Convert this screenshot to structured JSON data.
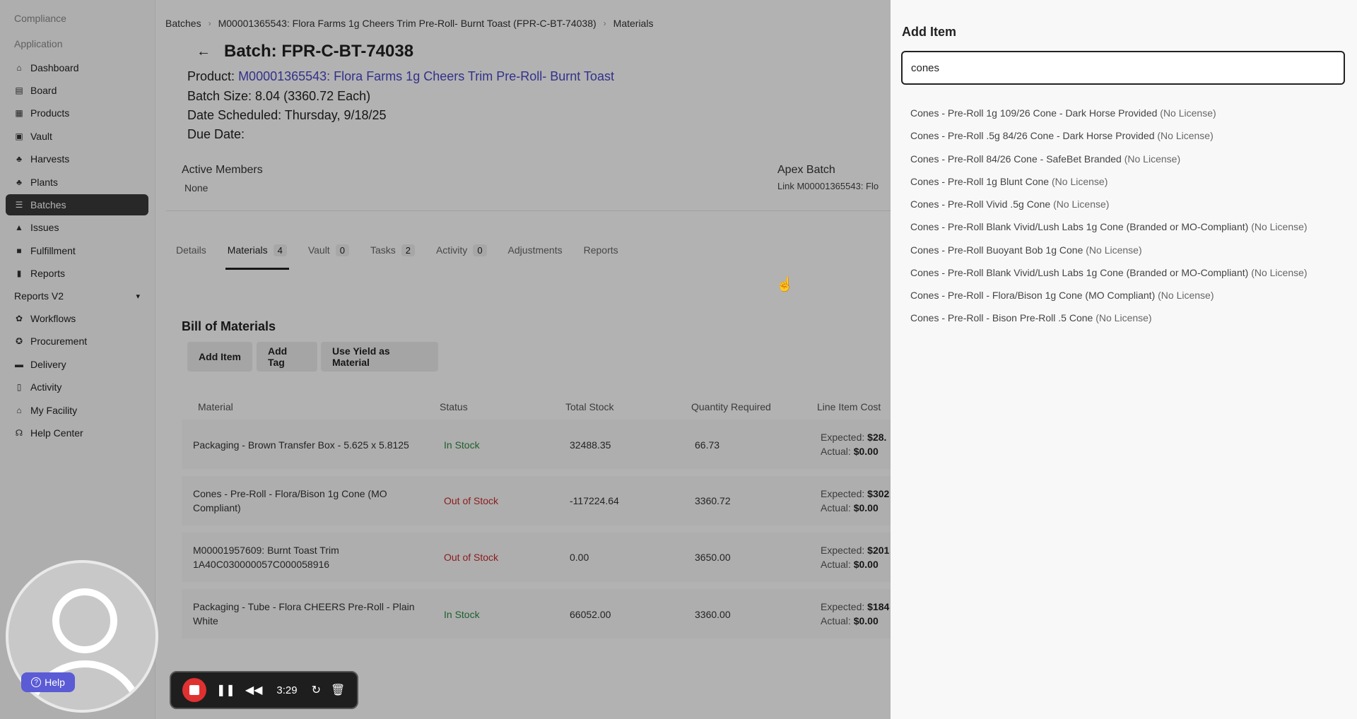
{
  "sidebar": {
    "sections": [
      "Compliance",
      "Application"
    ],
    "items": [
      {
        "label": "Dashboard",
        "icon": "home-icon"
      },
      {
        "label": "Board",
        "icon": "board-icon"
      },
      {
        "label": "Products",
        "icon": "products-icon"
      },
      {
        "label": "Vault",
        "icon": "vault-icon"
      },
      {
        "label": "Harvests",
        "icon": "harvest-icon"
      },
      {
        "label": "Plants",
        "icon": "plant-icon"
      },
      {
        "label": "Batches",
        "icon": "batches-icon",
        "active": true
      },
      {
        "label": "Issues",
        "icon": "warning-icon"
      },
      {
        "label": "Fulfillment",
        "icon": "fulfillment-icon"
      },
      {
        "label": "Reports",
        "icon": "chart-icon"
      },
      {
        "label": "Reports V2",
        "icon": "chevron-down-icon"
      },
      {
        "label": "Workflows",
        "icon": "workflow-icon"
      },
      {
        "label": "Procurement",
        "icon": "procurement-icon"
      },
      {
        "label": "Delivery",
        "icon": "truck-icon"
      },
      {
        "label": "Activity",
        "icon": "activity-icon"
      },
      {
        "label": "My Facility",
        "icon": "facility-icon"
      },
      {
        "label": "Help Center",
        "icon": "headset-icon"
      }
    ]
  },
  "breadcrumb": [
    "Batches",
    "M00001365543: Flora Farms 1g Cheers Trim Pre-Roll- Burnt Toast (FPR-C-BT-74038)",
    "Materials"
  ],
  "batch": {
    "title": "Batch: FPR-C-BT-74038",
    "product_label": "Product:",
    "product_link": "M00001365543: Flora Farms 1g Cheers Trim Pre-Roll- Burnt Toast",
    "size": "Batch Size: 8.04 (3360.72 Each)",
    "scheduled": "Date Scheduled: Thursday, 9/18/25",
    "due": "Due Date:"
  },
  "members": {
    "label": "Active Members",
    "value": "None"
  },
  "apex": {
    "label": "Apex Batch",
    "value": "Link M00001365543: Flo"
  },
  "tabs": [
    {
      "label": "Details"
    },
    {
      "label": "Materials",
      "count": "4",
      "active": true
    },
    {
      "label": "Vault",
      "count": "0"
    },
    {
      "label": "Tasks",
      "count": "2"
    },
    {
      "label": "Activity",
      "count": "0"
    },
    {
      "label": "Adjustments"
    },
    {
      "label": "Reports"
    }
  ],
  "bom": {
    "title": "Bill of Materials",
    "buttons": [
      "Add Item",
      "Add Tag",
      "Use Yield as Material"
    ],
    "columns": [
      "Material",
      "Status",
      "Total Stock",
      "Quantity Required",
      "Line Item Cost"
    ],
    "rows": [
      {
        "material": "Packaging - Brown Transfer Box - 5.625 x 5.8125",
        "status": "In Stock",
        "status_type": "in",
        "total": "32488.35",
        "qty": "66.73",
        "expected_label": "Expected:",
        "expected": "$28.",
        "actual_label": "Actual:",
        "actual": "$0.00"
      },
      {
        "material": "Cones - Pre-Roll - Flora/Bison 1g Cone (MO Compliant)",
        "status": "Out of Stock",
        "status_type": "out",
        "total": "-117224.64",
        "qty": "3360.72",
        "expected_label": "Expected:",
        "expected": "$302",
        "actual_label": "Actual:",
        "actual": "$0.00"
      },
      {
        "material": "M00001957609: Burnt Toast Trim 1A40C030000057C000058916",
        "status": "Out of Stock",
        "status_type": "out",
        "total": "0.00",
        "qty": "3650.00",
        "expected_label": "Expected:",
        "expected": "$201",
        "actual_label": "Actual:",
        "actual": "$0.00"
      },
      {
        "material": "Packaging - Tube - Flora CHEERS Pre-Roll - Plain White",
        "status": "In Stock",
        "status_type": "in",
        "total": "66052.00",
        "qty": "3360.00",
        "expected_label": "Expected:",
        "expected": "$184",
        "actual_label": "Actual:",
        "actual": "$0.00"
      }
    ]
  },
  "panel": {
    "title": "Add Item",
    "search_value": "cones",
    "options": [
      {
        "name": "Cones - Pre-Roll 1g 109/26 Cone - Dark Horse Provided",
        "license": "(No License)"
      },
      {
        "name": "Cones - Pre-Roll .5g 84/26 Cone - Dark Horse Provided",
        "license": "(No License)"
      },
      {
        "name": "Cones - Pre-Roll 84/26 Cone - SafeBet Branded",
        "license": "(No License)"
      },
      {
        "name": "Cones - Pre-Roll 1g Blunt Cone",
        "license": "(No License)"
      },
      {
        "name": "Cones - Pre-Roll Vivid .5g Cone",
        "license": "(No License)"
      },
      {
        "name": "Cones - Pre-Roll Blank Vivid/Lush Labs 1g Cone (Branded or MO-Compliant)",
        "license": "(No License)"
      },
      {
        "name": "Cones - Pre-Roll Buoyant Bob 1g Cone",
        "license": "(No License)"
      },
      {
        "name": "Cones - Pre-Roll Blank Vivid/Lush Labs 1g Cone (Branded or MO-Compliant)",
        "license": "(No License)"
      },
      {
        "name": "Cones - Pre-Roll - Flora/Bison 1g Cone (MO Compliant)",
        "license": "(No License)"
      },
      {
        "name": "Cones - Pre-Roll - Bison Pre-Roll .5 Cone",
        "license": "(No License)"
      }
    ]
  },
  "recorder": {
    "help_label": "Help",
    "timer": "3:29"
  },
  "colors": {
    "accent_link": "#4a47c8",
    "in_stock": "#2b8a3e",
    "out_of_stock": "#c92a2a",
    "record": "#e03131",
    "help": "#5b5bd6"
  }
}
